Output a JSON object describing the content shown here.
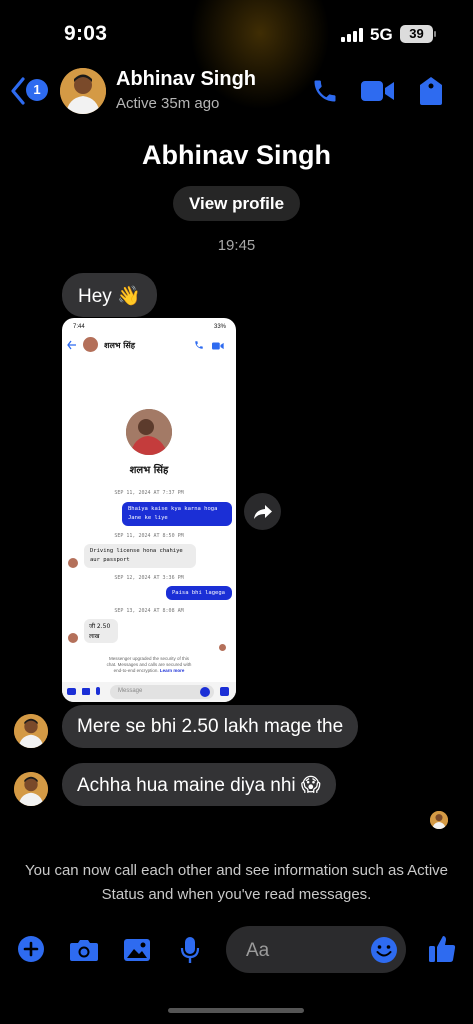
{
  "status_bar": {
    "time": "9:03",
    "network": "5G",
    "battery": "39"
  },
  "header": {
    "back_badge": "1",
    "contact_name": "Abhinav Singh",
    "contact_status": "Active 35m ago",
    "icons": [
      "back-chevron-icon",
      "phone-icon",
      "video-camera-icon",
      "info-tag-icon"
    ],
    "accent_color": "#2e6bf0"
  },
  "profile": {
    "name": "Abhinav Singh",
    "view_profile_label": "View profile"
  },
  "conversation": {
    "timestamp": "19:45",
    "messages": [
      {
        "text": "Hey 👋"
      },
      {
        "text": "Mere se bhi 2.50 lakh mage the"
      },
      {
        "text": "Achha hua maine diya nhi 😱"
      }
    ]
  },
  "shared_screenshot": {
    "status": "7:44",
    "battery": "33%",
    "name": "शलभ सिंह",
    "date1": "SEP 11, 2024 AT 7:37 PM",
    "sent1_line1": "Bhaiya kaise kya karna hoga",
    "sent1_line2": "Jane ke liye",
    "date2": "SEP 11, 2024 AT 8:50 PM",
    "recv1_line1": "Driving license hona chahiye",
    "recv1_line2": "aur passport",
    "date3": "SEP 12, 2024 AT 3:36 PM",
    "sent2": "Paisa bhi lagega",
    "date4": "SEP 13, 2024 AT 8:08 AM",
    "recv2_line1": "जी 2.50",
    "recv2_line2": "लाख",
    "notice_line1": "Messenger upgraded the security of this",
    "notice_line2": "chat. Messages and calls are secured with",
    "notice_line3": "end-to-end encryption.",
    "learn_more": "Learn more",
    "input_placeholder": "Message"
  },
  "info": {
    "text": "You can now call each other and see information such as Active Status and when you've read messages."
  },
  "composer": {
    "placeholder": "Aa",
    "icons": [
      "plus-icon",
      "camera-icon",
      "gallery-icon",
      "microphone-icon",
      "emoji-icon",
      "thumbs-up-icon"
    ]
  }
}
